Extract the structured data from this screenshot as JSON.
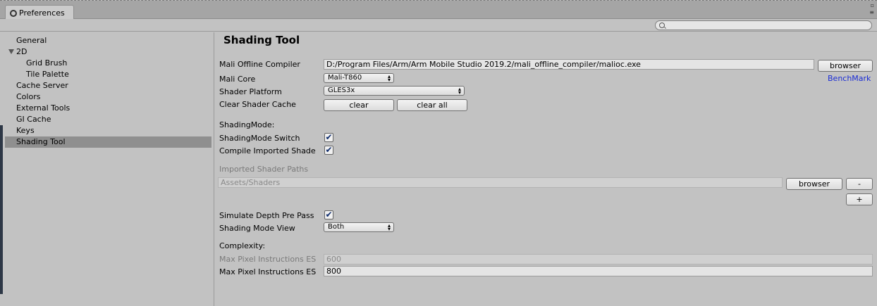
{
  "window": {
    "tab_title": "Preferences",
    "tab_icon": "gear-icon",
    "controls": [
      "▫",
      "≡"
    ]
  },
  "search": {
    "placeholder": "",
    "icon": "search-icon"
  },
  "sidebar": {
    "items": [
      {
        "label": "General",
        "level": 0
      },
      {
        "label": "2D",
        "level": 0,
        "expanded": true
      },
      {
        "label": "Grid Brush",
        "level": 1
      },
      {
        "label": "Tile Palette",
        "level": 1
      },
      {
        "label": "Cache Server",
        "level": 0
      },
      {
        "label": "Colors",
        "level": 0
      },
      {
        "label": "External Tools",
        "level": 0
      },
      {
        "label": "GI Cache",
        "level": 0
      },
      {
        "label": "Keys",
        "level": 0
      },
      {
        "label": "Shading Tool",
        "level": 0,
        "selected": true
      }
    ]
  },
  "main": {
    "title": "Shading Tool",
    "mali_compiler": {
      "label": "Mali Offline Compiler",
      "value": "D:/Program Files/Arm/Arm Mobile Studio 2019.2/mali_offline_compiler/malioc.exe",
      "browse_label": "browser"
    },
    "mali_core": {
      "label": "Mali Core",
      "value": "Mali-T860"
    },
    "benchmark_label": "BenchMark",
    "shader_platform": {
      "label": "Shader Platform",
      "value": "GLES3x"
    },
    "clear_cache": {
      "label": "Clear Shader Cache",
      "clear_label": "clear",
      "clear_all_label": "clear all"
    },
    "shading_mode_header": "ShadingMode:",
    "shading_mode_switch": {
      "label": "ShadingMode Switch",
      "checked": true
    },
    "compile_imported": {
      "label": "Compile Imported Shade",
      "checked": true
    },
    "imported_paths": {
      "label": "Imported Shader Paths",
      "value": "Assets/Shaders",
      "browse_label": "browser",
      "remove_label": "-",
      "add_label": "+"
    },
    "simulate_depth": {
      "label": "Simulate Depth Pre Pass",
      "checked": true
    },
    "shading_mode_view": {
      "label": "Shading Mode View",
      "value": "Both"
    },
    "complexity_header": "Complexity:",
    "max_pixel_disabled": {
      "label": "Max Pixel Instructions ES",
      "value": "600"
    },
    "max_pixel": {
      "label": "Max Pixel Instructions ES",
      "value": "800"
    },
    "checkmark": "✔"
  },
  "colors": {
    "accent_link": "#1a2cd6",
    "selected_row": "#8f8f8f"
  }
}
